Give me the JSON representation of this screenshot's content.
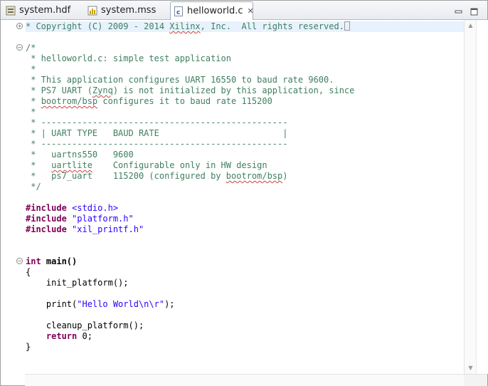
{
  "tabs": [
    {
      "label": "system.hdf",
      "icon": "hdf-file-icon",
      "active": false
    },
    {
      "label": "system.mss",
      "icon": "mss-file-icon",
      "active": false
    },
    {
      "label": "helloworld.c",
      "icon": "c-file-icon",
      "active": true,
      "close": "✕"
    }
  ],
  "window": {
    "minimize": "minimize-icon",
    "maximize": "maximize-icon"
  },
  "code": {
    "l1": "* Copyright (C) 2009 - 2014 ",
    "l1_sq": "Xilinx",
    "l1_rest": ", Inc.  All rights reserved.",
    "l3": "/*",
    "l4": " * helloworld.c: simple test application",
    "l5": " *",
    "l6": " * This application configures UART 16550 to baud rate 9600.",
    "l7a": " * PS7 UART (",
    "l7_sq": "Zynq",
    "l7b": ") is not initialized by this application, since",
    "l8a": " * ",
    "l8_sq": "bootrom/bsp",
    "l8b": " configures it to baud rate 115200",
    "l9": " *",
    "l10": " * ------------------------------------------------",
    "l11": " * | UART TYPE   BAUD RATE                        |",
    "l12": " * ------------------------------------------------",
    "l13": " *   uartns550   9600",
    "l14a": " *   ",
    "l14_sq": "uartlite",
    "l14b": "    Configurable only in HW design",
    "l15a": " *   ps7_uart    115200 (configured by ",
    "l15_sq": "bootrom/bsp",
    "l15b": ")",
    "l16": " */",
    "inc_kw": "#include",
    "inc1": "<stdio.h>",
    "inc2": "\"platform.h\"",
    "inc3": "\"xil_printf.h\"",
    "kw_int": "int",
    "main_sig": " main()",
    "brace_open": "{",
    "init": "    init_platform();",
    "print_a": "    print(",
    "print_str": "\"Hello World\\n\\r\"",
    "print_b": ");",
    "cleanup": "    cleanup_platform();",
    "kw_return": "return",
    "return_rest": " 0;",
    "brace_close": "}"
  },
  "folds": {
    "expand": "+",
    "collapse": "−"
  }
}
